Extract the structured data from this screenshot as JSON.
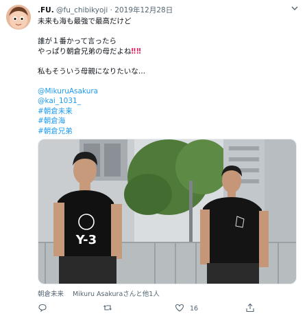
{
  "tweet": {
    "display_name": ".FU.",
    "handle": "@fu_chibikyoji",
    "separator": "·",
    "date": "2019年12月28日",
    "text_lines": [
      "未来も海も最強で最高だけど",
      "",
      "誰が１番かって言ったら",
      "やっぱり朝倉兄弟の母だよね",
      "",
      "私もそういう母親になりたいな…",
      ""
    ],
    "exclamation": "‼︎‼︎",
    "mentions": [
      "@MikuruAsakura",
      "@kai_1031_"
    ],
    "hashtags": [
      "#朝倉未来",
      "#朝倉海",
      "#朝倉兄弟"
    ],
    "photo_tags": [
      "朝倉未来",
      "Mikuru Asakuraさんと他1人"
    ],
    "actions": {
      "reply_count": "",
      "retweet_count": "",
      "like_count": "16",
      "share_label": ""
    },
    "photo_shirt_text": "Y-3",
    "icon_names": [
      "avatar",
      "chevron-down-icon",
      "reply-icon",
      "retweet-icon",
      "like-icon",
      "share-icon"
    ]
  }
}
